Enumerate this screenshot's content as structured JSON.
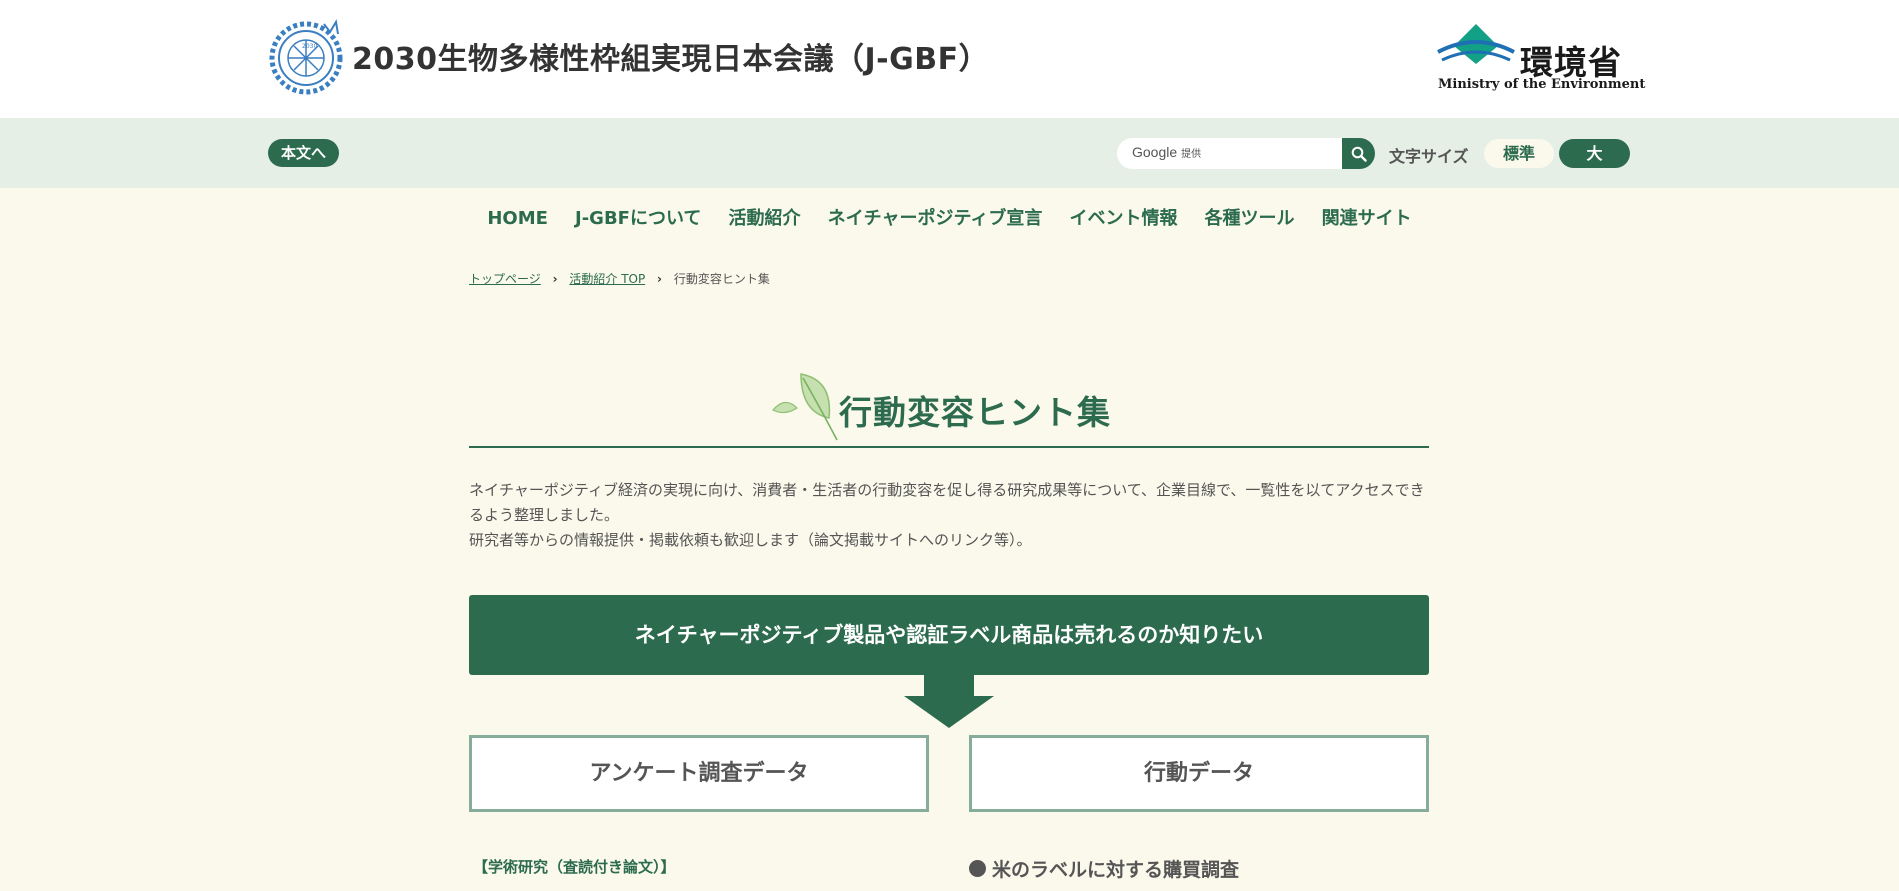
{
  "header": {
    "site_title": "2030生物多様性枠組実現日本会議（J-GBF）",
    "logo_icon": "j-gbf-emblem-icon",
    "ministry_logo": {
      "jp": "環境省",
      "en": "Ministry of the Environment",
      "icon": "ministry-mark-icon"
    }
  },
  "utility": {
    "skip_label": "本文へ",
    "search": {
      "brand": "Google",
      "brand_suffix": "提供",
      "placeholder": "",
      "button_icon": "search-icon"
    },
    "font_size_label": "文字サイズ",
    "font_normal": "標準",
    "font_large": "大"
  },
  "nav": {
    "items": [
      {
        "label": "HOME"
      },
      {
        "label": "J-GBFについて"
      },
      {
        "label": "活動紹介"
      },
      {
        "label": "ネイチャーポジティブ宣言"
      },
      {
        "label": "イベント情報"
      },
      {
        "label": "各種ツール"
      },
      {
        "label": "関連サイト"
      }
    ]
  },
  "breadcrumb": {
    "home": "トップページ",
    "parent": "活動紹介 TOP",
    "current": "行動変容ヒント集"
  },
  "main": {
    "title": "行動変容ヒント集",
    "title_icon": "leaf-icon",
    "intro_line1": "ネイチャーポジティブ経済の実現に向け、消費者・生活者の行動変容を促し得る研究成果等について、企業目線で、一覧性を以てアクセスできるよう整理しました。",
    "intro_line2": "研究者等からの情報提供・掲載依頼も歓迎します（論文掲載サイトへのリンク等）。",
    "question": "ネイチャーポジティブ製品や認証ラベル商品は売れるのか知りたい",
    "button_survey": "アンケート調査データ",
    "button_behavior": "行動データ",
    "section_label": "【学術研究（査読付き論文）】",
    "item_title": "米のラベルに対する購買調査"
  },
  "colors": {
    "primary": "#2c6b4e",
    "background": "#fbf9ec",
    "utility_bar": "#e6efe6",
    "button_border": "#86ad9a"
  }
}
